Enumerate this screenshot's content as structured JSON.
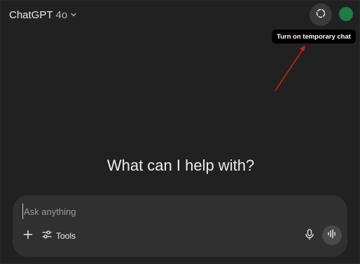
{
  "header": {
    "model_name": "ChatGPT",
    "model_version": "4o",
    "temporary_chat_icon": "dashed-circle-icon",
    "avatar_color": "#1e7a4a"
  },
  "tooltip": {
    "text": "Turn on temporary chat"
  },
  "annotation": {
    "arrow_color": "#d32020"
  },
  "main": {
    "headline": "What can I help with?"
  },
  "composer": {
    "placeholder": "Ask anything",
    "value": "",
    "plus_icon": "plus-icon",
    "tools_label": "Tools",
    "tools_icon": "sliders-icon",
    "mic_icon": "microphone-icon",
    "voice_icon": "voice-waveform-icon"
  },
  "colors": {
    "background": "#212121",
    "composer_background": "#303030",
    "text": "#ececec"
  }
}
